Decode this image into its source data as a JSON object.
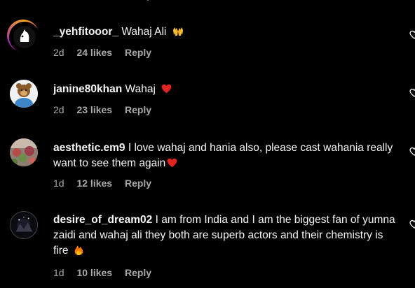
{
  "comments": [
    {
      "username": "_yehfitooor_",
      "text": "Wahaj Ali",
      "emoji": "raised-hands-icon",
      "time": "2d",
      "likes": "24 likes",
      "reply": "Reply"
    },
    {
      "username": "janine80khan",
      "text": "Wahaj",
      "emoji": "red-heart-icon",
      "time": "2d",
      "likes": "23 likes",
      "reply": "Reply"
    },
    {
      "username": "aesthetic.em9",
      "text": "I love wahaj and hania also, please cast wahania really want to see them again",
      "emoji": "red-heart-icon",
      "time": "1d",
      "likes": "12 likes",
      "reply": "Reply"
    },
    {
      "username": "desire_of_dream02",
      "text": "I am from India and I am the biggest fan of yumna zaidi and wahaj ali they both are superb actors and their chemistry is fire",
      "emoji": "fire-icon",
      "time": "1d",
      "likes": "10 likes",
      "reply": "Reply"
    }
  ],
  "colors": {
    "background": "#000000",
    "text": "#f5f5f5",
    "meta": "#a8a8a8",
    "story_ring_start": "#f9a825",
    "story_ring_end": "#c2185b"
  }
}
